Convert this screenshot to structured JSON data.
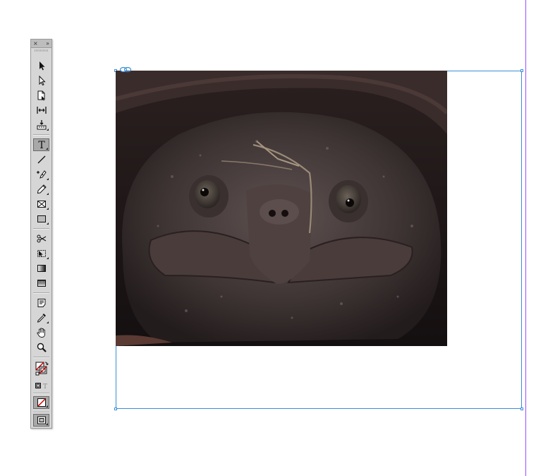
{
  "tools_panel": {
    "title_left": "×",
    "title_right": "»",
    "tools": [
      {
        "name": "selection-tool",
        "icon": "arrow-icon"
      },
      {
        "name": "direct-selection-tool",
        "icon": "hollow-arrow-icon"
      },
      {
        "name": "page-tool",
        "icon": "page-icon"
      },
      {
        "name": "gap-tool",
        "icon": "gap-icon"
      },
      {
        "name": "content-collector-tool",
        "icon": "collector-icon"
      },
      {
        "name": "type-tool",
        "icon": "type-icon",
        "selected": true
      },
      {
        "name": "line-tool",
        "icon": "line-icon"
      },
      {
        "name": "pen-tool",
        "icon": "pen-icon"
      },
      {
        "name": "pencil-tool",
        "icon": "pencil-icon"
      },
      {
        "name": "rectangle-frame-tool",
        "icon": "frame-x-icon"
      },
      {
        "name": "rectangle-tool",
        "icon": "rectangle-icon"
      },
      {
        "name": "scissors-tool",
        "icon": "scissors-icon"
      },
      {
        "name": "free-transform-tool",
        "icon": "transform-icon"
      },
      {
        "name": "gradient-swatch-tool",
        "icon": "gradient-icon"
      },
      {
        "name": "gradient-feather-tool",
        "icon": "feather-icon"
      },
      {
        "name": "note-tool",
        "icon": "note-icon"
      },
      {
        "name": "eyedropper-tool",
        "icon": "eyedropper-icon"
      },
      {
        "name": "hand-tool",
        "icon": "hand-icon"
      },
      {
        "name": "zoom-tool",
        "icon": "magnifier-icon"
      },
      {
        "name": "fill-stroke-swatch",
        "icon": "fill-stroke-icon"
      },
      {
        "name": "formatting-affects",
        "icon": "container-text-icon"
      },
      {
        "name": "apply-none",
        "icon": "none-icon"
      },
      {
        "name": "screen-mode",
        "icon": "screen-mode-icon"
      }
    ],
    "type_glyph": "T"
  },
  "document": {
    "frame_content": "snapping-turtle-photo"
  },
  "colors": {
    "frame_border": "#3b8ed6",
    "guide": "#9b4dff",
    "panel": "#d6d6d6"
  }
}
